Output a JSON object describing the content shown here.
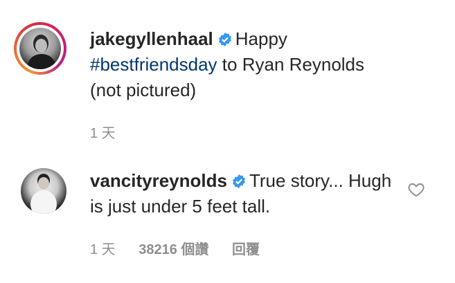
{
  "comments": [
    {
      "username": "jakegyllenhaal",
      "verified": true,
      "text_before": "Happy",
      "hashtag": "#bestfriendsday",
      "text_after": "to Ryan Reynolds (not pictured)",
      "time": "1 天"
    },
    {
      "username": "vancityreynolds",
      "verified": true,
      "text": "True story... Hugh is just under 5 feet tall.",
      "time": "1 天",
      "likes": "38216 個讚",
      "reply": "回覆"
    }
  ],
  "colors": {
    "text": "#262626",
    "meta": "#8e8e8e",
    "hashtag": "#00376b",
    "verified": "#3897f0"
  },
  "icons": [
    "verified-badge-icon",
    "heart-icon"
  ]
}
